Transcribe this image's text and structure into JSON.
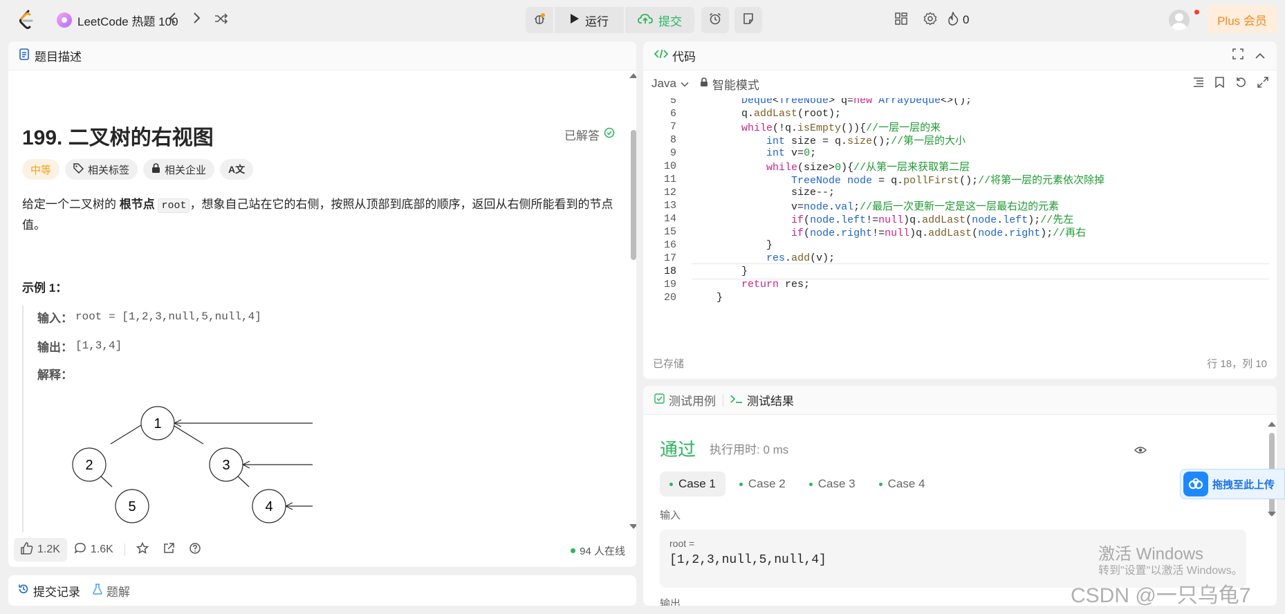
{
  "topbar": {
    "list_title": "LeetCode 热题 100",
    "run_label": "运行",
    "submit_label": "提交",
    "fire_count": "0",
    "plus_label": "Plus 会员"
  },
  "description": {
    "tab_label": "题目描述",
    "title": "199. 二叉树的右视图",
    "solved_label": "已解答",
    "tags": {
      "difficulty": "中等",
      "related_tags": "相关标签",
      "related_companies": "相关企业",
      "translate": "A文"
    },
    "text_before": "给定一个二叉树的 ",
    "text_bold": "根节点",
    "text_code": "root",
    "text_after": "，想象自己站在它的右侧，按照从顶部到底部的顺序，返回从右侧所能看到的节点值。",
    "example_title": "示例 1：",
    "input_label": "输入：",
    "input_value": "root = [1,2,3,null,5,null,4]",
    "output_label": "输出：",
    "output_value": "[1,3,4]",
    "explain_label": "解释：",
    "tree_nodes": [
      "1",
      "2",
      "3",
      "5",
      "4"
    ]
  },
  "desc_footer": {
    "likes": "1.2K",
    "comments": "1.6K",
    "online": "94 人在线"
  },
  "bottom_tabs": {
    "submissions": "提交记录",
    "solutions": "题解"
  },
  "code_panel": {
    "tab_label": "代码",
    "language": "Java",
    "mode": "智能模式",
    "saved_label": "已存储",
    "cursor_position": "行 18，列 10"
  },
  "test_panel": {
    "tab_testcase": "测试用例",
    "tab_result": "测试结果",
    "result": "通过",
    "exec_time": "执行用时: 0 ms",
    "cases": [
      "Case 1",
      "Case 2",
      "Case 3",
      "Case 4"
    ],
    "input_label": "输入",
    "input_var": "root =",
    "input_value": "[1,2,3,null,5,null,4]",
    "output_label_partial": "输出"
  },
  "overlays": {
    "baidu_label": "拖拽至此上传",
    "activate_title": "激活 Windows",
    "activate_sub": "转到\"设置\"以激活 Windows。",
    "csdn_watermark": "CSDN @一只乌龟7"
  },
  "colors": {
    "accent_green": "#2db55d",
    "difficulty_orange": "#f0a020",
    "plus_orange": "#f08a24",
    "keyword": "#c8248a",
    "type": "#1f63c8",
    "comment": "#1f9a33"
  }
}
